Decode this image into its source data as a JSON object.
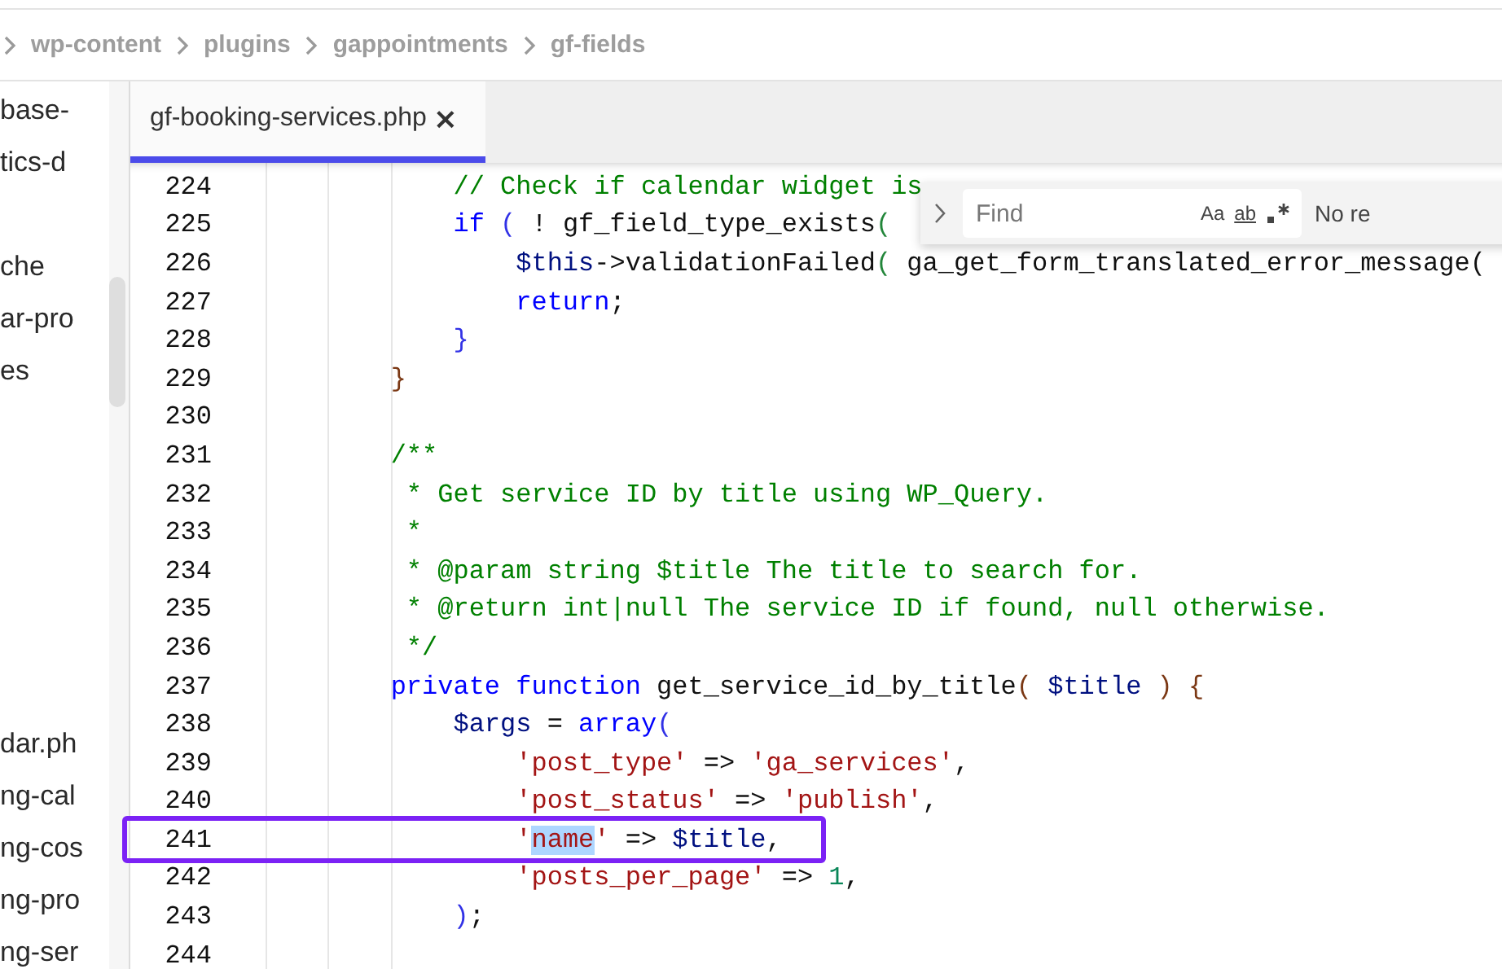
{
  "breadcrumb": [
    "wp-content",
    "plugins",
    "gappointments",
    "gf-fields"
  ],
  "sidebar": {
    "groups": [
      {
        "items": [
          "base-",
          "tics-d"
        ]
      },
      {
        "items": [
          "che",
          "ar-pro",
          "es"
        ]
      },
      {
        "items": [
          "dar.ph",
          "ng-cal",
          "ng-cos",
          "ng-pro",
          "ng-ser"
        ]
      }
    ]
  },
  "tabs": [
    {
      "label": "gf-booking-services.php",
      "close": "×",
      "selected": true
    }
  ],
  "find_widget": {
    "placeholder": "Find",
    "toggles": [
      "Aa",
      "ab"
    ],
    "result": "No re"
  },
  "code": {
    "lines": [
      {
        "number": "224",
        "boxed": false,
        "tokens": [
          {
            "kind": "comment",
            "t": "            // Check if calendar widget is"
          }
        ]
      },
      {
        "number": "225",
        "boxed": false,
        "tokens": [
          {
            "kind": "kw",
            "t": "            if"
          },
          {
            "kind": "b2",
            "t": " ("
          },
          {
            "kind": "plain",
            "t": " ! "
          },
          {
            "kind": "fn",
            "t": "gf_field_type_exists"
          },
          {
            "kind": "b3",
            "t": "("
          }
        ]
      },
      {
        "number": "226",
        "boxed": false,
        "tokens": [
          {
            "kind": "var",
            "t": "                $this"
          },
          {
            "kind": "plain",
            "t": "->validationFailed"
          },
          {
            "kind": "b3",
            "t": "("
          },
          {
            "kind": "plain",
            "t": " ga_get_form_translated_error_message("
          }
        ]
      },
      {
        "number": "227",
        "boxed": false,
        "tokens": [
          {
            "kind": "kw",
            "t": "                return"
          },
          {
            "kind": "plain",
            "t": ";"
          }
        ]
      },
      {
        "number": "228",
        "boxed": false,
        "tokens": [
          {
            "kind": "b2",
            "t": "            }"
          }
        ]
      },
      {
        "number": "229",
        "boxed": false,
        "tokens": [
          {
            "kind": "b1",
            "t": "        }"
          }
        ]
      },
      {
        "number": "230",
        "boxed": false
      },
      {
        "number": "231",
        "boxed": false,
        "tokens": [
          {
            "kind": "comment",
            "t": "        /**"
          }
        ]
      },
      {
        "number": "232",
        "boxed": false,
        "tokens": [
          {
            "kind": "comment",
            "t": "         * Get service ID by title using WP_Query."
          }
        ]
      },
      {
        "number": "233",
        "boxed": false,
        "tokens": [
          {
            "kind": "comment",
            "t": "         *"
          }
        ]
      },
      {
        "number": "234",
        "boxed": false,
        "tokens": [
          {
            "kind": "comment",
            "t": "         * @param string $title The title to search for."
          }
        ]
      },
      {
        "number": "235",
        "boxed": false,
        "tokens": [
          {
            "kind": "comment",
            "t": "         * @return int|null The service ID if found, null otherwise."
          }
        ]
      },
      {
        "number": "236",
        "boxed": false,
        "tokens": [
          {
            "kind": "comment",
            "t": "         */"
          }
        ]
      },
      {
        "number": "237",
        "boxed": false,
        "tokens": [
          {
            "kind": "kw",
            "t": "        private function"
          },
          {
            "kind": "fn",
            "t": " get_service_id_by_title"
          },
          {
            "kind": "b1",
            "t": "("
          },
          {
            "kind": "var",
            "t": " $title"
          },
          {
            "kind": "b1",
            "t": " ) {"
          }
        ]
      },
      {
        "number": "238",
        "boxed": false,
        "tokens": [
          {
            "kind": "var",
            "t": "            $args"
          },
          {
            "kind": "plain",
            "t": " = "
          },
          {
            "kind": "kw",
            "t": "array"
          },
          {
            "kind": "b2",
            "t": "("
          }
        ]
      },
      {
        "number": "239",
        "boxed": false,
        "tokens": [
          {
            "kind": "str",
            "t": "                'post_type'"
          },
          {
            "kind": "plain",
            "t": " => "
          },
          {
            "kind": "str",
            "t": "'ga_services'"
          },
          {
            "kind": "plain",
            "t": ","
          }
        ]
      },
      {
        "number": "240",
        "boxed": false,
        "tokens": [
          {
            "kind": "str",
            "t": "                'post_status'"
          },
          {
            "kind": "plain",
            "t": " => "
          },
          {
            "kind": "str",
            "t": "'publish'"
          },
          {
            "kind": "plain",
            "t": ","
          }
        ]
      },
      {
        "number": "241",
        "boxed": true,
        "tokens": [
          {
            "kind": "str",
            "t": "                '"
          },
          {
            "kind": "str-selected",
            "t": "name"
          },
          {
            "kind": "str",
            "t": "'"
          },
          {
            "kind": "plain",
            "t": " => "
          },
          {
            "kind": "var",
            "t": "$title"
          },
          {
            "kind": "plain",
            "t": ","
          }
        ]
      },
      {
        "number": "242",
        "boxed": false,
        "tokens": [
          {
            "kind": "str",
            "t": "                'posts_per_page'"
          },
          {
            "kind": "plain",
            "t": " => "
          },
          {
            "kind": "num",
            "t": "1"
          },
          {
            "kind": "plain",
            "t": ","
          }
        ]
      },
      {
        "number": "243",
        "boxed": false,
        "tokens": [
          {
            "kind": "b2",
            "t": "            )"
          },
          {
            "kind": "plain",
            "t": ";"
          }
        ]
      },
      {
        "number": "244",
        "boxed": false
      }
    ]
  }
}
